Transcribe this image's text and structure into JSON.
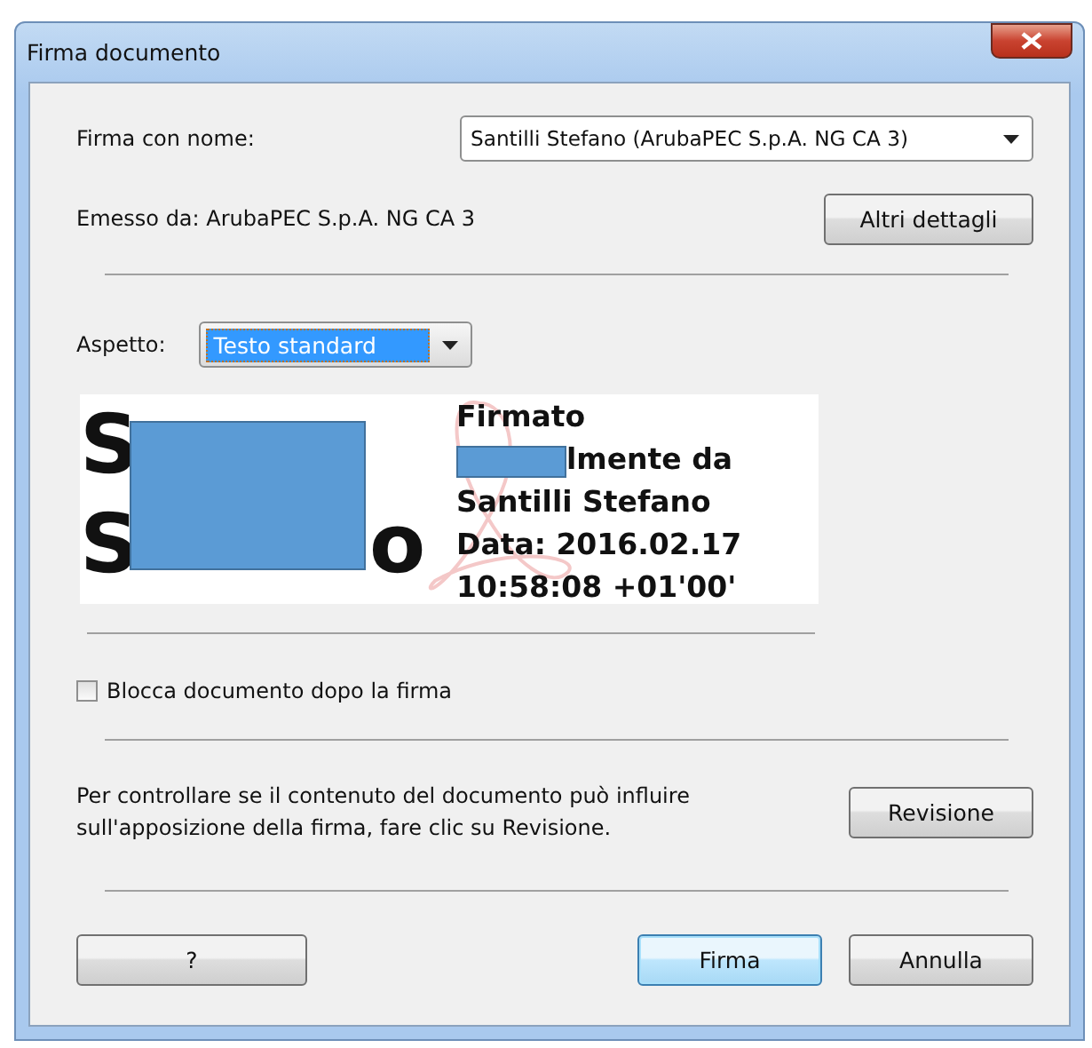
{
  "window": {
    "title": "Firma documento"
  },
  "sign_as": {
    "label": "Firma con nome:",
    "value": "Santilli Stefano (ArubaPEC S.p.A. NG CA 3)"
  },
  "issuer": {
    "text": "Emesso da: ArubaPEC S.p.A. NG CA 3",
    "button": "Altri dettagli"
  },
  "appearance": {
    "label": "Aspetto:",
    "value": "Testo standard"
  },
  "preview": {
    "name_heads": [
      "S",
      "S"
    ],
    "name_tail": "o",
    "lines": [
      {
        "text": "Firmato",
        "redacted": false
      },
      {
        "text": "lmente da",
        "redacted": true
      },
      {
        "text": "Santilli Stefano",
        "redacted": false
      },
      {
        "text": "Data: 2016.02.17",
        "redacted": false
      },
      {
        "text": "10:58:08 +01'00'",
        "redacted": false
      }
    ]
  },
  "lock": {
    "label": "Blocca documento dopo la firma",
    "checked": false
  },
  "review": {
    "lines": [
      "Per controllare se il contenuto del documento può influire",
      "sull'apposizione della firma, fare clic su Revisione."
    ],
    "button": "Revisione"
  },
  "buttons": [
    {
      "label": "?",
      "default": false
    },
    {
      "label": "Firma",
      "default": true
    },
    {
      "label": "Annulla",
      "default": false
    }
  ]
}
